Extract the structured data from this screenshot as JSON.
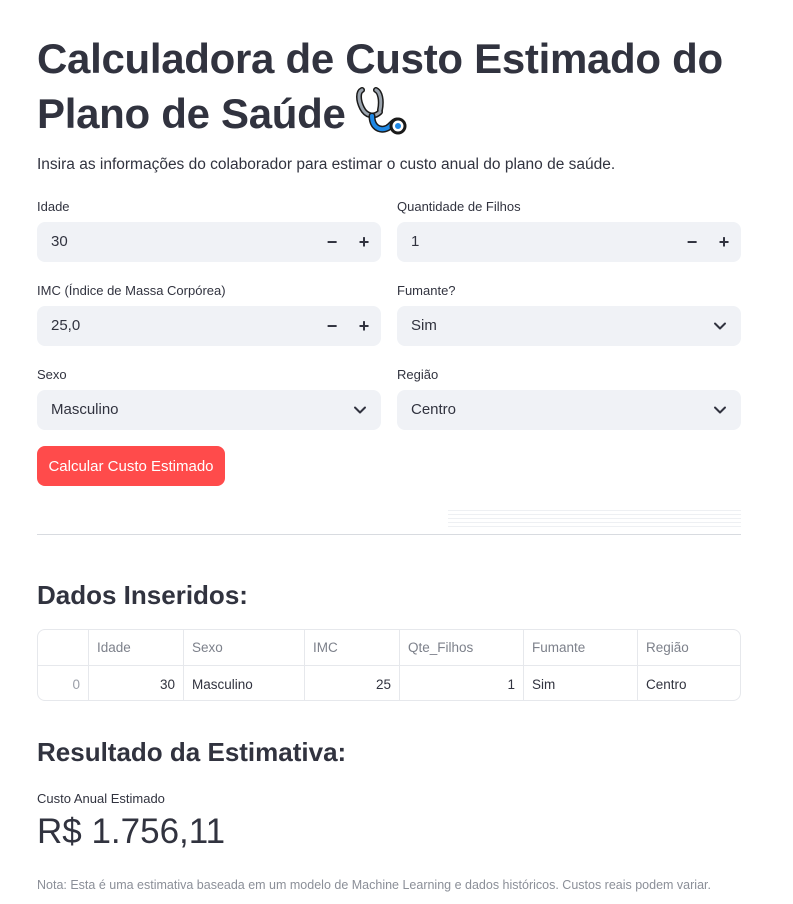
{
  "header": {
    "title": "Calculadora de Custo Estimado do Plano de Saúde",
    "title_icon": "stethoscope-icon",
    "subtitle": "Insira as informações do colaborador para estimar o custo anual do plano de saúde."
  },
  "form": {
    "idade": {
      "label": "Idade",
      "value": "30"
    },
    "filhos": {
      "label": "Quantidade de Filhos",
      "value": "1"
    },
    "imc": {
      "label": "IMC (Índice de Massa Corpórea)",
      "value": "25,0"
    },
    "fumante": {
      "label": "Fumante?",
      "value": "Sim"
    },
    "sexo": {
      "label": "Sexo",
      "value": "Masculino"
    },
    "regiao": {
      "label": "Região",
      "value": "Centro"
    },
    "stepper_minus": "−",
    "stepper_plus": "+",
    "submit_label": "Calcular Custo Estimado"
  },
  "table": {
    "title": "Dados Inseridos:",
    "columns": [
      "",
      "Idade",
      "Sexo",
      "IMC",
      "Qte_Filhos",
      "Fumante",
      "Região"
    ],
    "rows": [
      [
        "0",
        "30",
        "Masculino",
        "25",
        "1",
        "Sim",
        "Centro"
      ]
    ]
  },
  "result": {
    "title": "Resultado da Estimativa:",
    "metric_label": "Custo Anual Estimado",
    "metric_value": "R$ 1.756,11",
    "note": "Nota: Esta é uma estimativa baseada em um modelo de Machine Learning e dados históricos. Custos reais podem variar."
  },
  "colors": {
    "primary_button": "#ff4b4b",
    "input_background": "#f0f2f6",
    "text": "#31333f"
  }
}
